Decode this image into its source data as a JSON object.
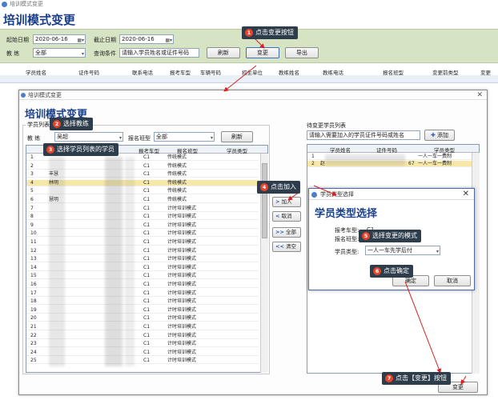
{
  "window": {
    "title": "培训模式变更"
  },
  "page": {
    "title": "培训模式变更"
  },
  "filter": {
    "start_label": "起始日期",
    "start_value": "2020-06-16",
    "end_label": "截止日期",
    "end_value": "2020-06-16",
    "coach_label": "教    练",
    "coach_value": "全部",
    "query_label": "查询条件",
    "query_placeholder": "请输入学员姓名或证件号码",
    "refresh_label": "刷新",
    "change_label": "变更",
    "export_label": "导出"
  },
  "main_table": {
    "columns": [
      "学员姓名",
      "证件号码",
      "联系电话",
      "报考车型",
      "车辆号码",
      "招生单位",
      "教练姓名",
      "教练电话",
      "报名班型",
      "变更前类型",
      "变更"
    ]
  },
  "dialog": {
    "title": "培训模式变更",
    "heading": "培训模式变更",
    "list_label": "学员列表",
    "coach_label": "教    练",
    "coach_value": "吴超",
    "class_label": "报名班型",
    "class_value": "全部",
    "refresh_label": "刷新",
    "columns": [
      "报考车型",
      "报名班型",
      "学员类型"
    ],
    "rows": [
      {
        "no": "1",
        "partial": "",
        "type": "C1",
        "class": "传统模式"
      },
      {
        "no": "2",
        "partial": "",
        "type": "C1",
        "class": "传统模式"
      },
      {
        "no": "3",
        "partial": "丰慧",
        "type": "C1",
        "class": "传统模式"
      },
      {
        "no": "4",
        "partial": "林明",
        "type": "C1",
        "class": "传统模式"
      },
      {
        "no": "5",
        "partial": "",
        "type": "C1",
        "class": "传统模式"
      },
      {
        "no": "6",
        "partial": "慧明",
        "type": "C1",
        "class": "传统模式"
      },
      {
        "no": "7",
        "partial": "",
        "type": "C1",
        "class": "计时培训模式"
      },
      {
        "no": "8",
        "partial": "",
        "type": "C1",
        "class": "计时培训模式"
      },
      {
        "no": "9",
        "partial": "",
        "type": "C1",
        "class": "计时培训模式"
      },
      {
        "no": "10",
        "partial": "",
        "type": "C1",
        "class": "计时培训模式"
      },
      {
        "no": "11",
        "partial": "",
        "type": "C1",
        "class": "计时培训模式"
      },
      {
        "no": "12",
        "partial": "",
        "type": "C1",
        "class": "计时培训模式"
      },
      {
        "no": "13",
        "partial": "",
        "type": "C1",
        "class": "计时培训模式"
      },
      {
        "no": "14",
        "partial": "",
        "type": "C1",
        "class": "计时培训模式"
      },
      {
        "no": "15",
        "partial": "",
        "type": "C1",
        "class": "计时培训模式"
      },
      {
        "no": "16",
        "partial": "",
        "type": "C1",
        "class": "计时培训模式"
      },
      {
        "no": "17",
        "partial": "",
        "type": "C1",
        "class": "计时培训模式"
      },
      {
        "no": "18",
        "partial": "",
        "type": "C1",
        "class": "计时培训模式"
      },
      {
        "no": "19",
        "partial": "",
        "type": "C1",
        "class": "计时培训模式"
      },
      {
        "no": "20",
        "partial": "",
        "type": "C1",
        "class": "计时培训模式"
      },
      {
        "no": "21",
        "partial": "",
        "type": "C1",
        "class": "计时培训模式"
      },
      {
        "no": "22",
        "partial": "",
        "type": "C1",
        "class": "计时培训模式"
      },
      {
        "no": "23",
        "partial": "",
        "type": "C1",
        "class": "计时培训模式"
      },
      {
        "no": "24",
        "partial": "",
        "type": "C1",
        "class": "计时培训模式"
      },
      {
        "no": "25",
        "partial": "",
        "type": "C1",
        "class": "计时培训模式"
      }
    ],
    "add_label": "加入",
    "remove_label": "取消",
    "all_label": "全部",
    "clear_label": "清空",
    "pending_label": "待变更学员列表",
    "pending_placeholder": "请输入需要加入的学员证件号码或姓名",
    "pending_add_label": "添加",
    "pending_columns": [
      "学员姓名",
      "证件号码",
      "学员类型"
    ],
    "pending_rows": [
      {
        "no": "1",
        "id_suffix": "",
        "type": "一人一车一费制"
      },
      {
        "no": "2",
        "name_partial": "赵",
        "id_suffix": "67",
        "type": "一人一车一费制"
      }
    ],
    "change_label": "变更"
  },
  "subdialog": {
    "title": "学员类型选择",
    "heading": "学员类型选择",
    "car_label": "报考车型:",
    "car_value": "C1",
    "class_label": "报名班型:",
    "student_type_label": "学员类型:",
    "student_type_value": "一人一车先学后付",
    "ok_label": "确定",
    "cancel_label": "取消"
  },
  "callouts": [
    {
      "num": "1",
      "text": "点击变更按钮"
    },
    {
      "num": "2",
      "text": "选择教练"
    },
    {
      "num": "3",
      "text": "选择学员列表的学员"
    },
    {
      "num": "4",
      "text": "点击加入"
    },
    {
      "num": "5",
      "text": "选择变更的模式"
    },
    {
      "num": "6",
      "text": "点击确定"
    },
    {
      "num": "7",
      "text": "点击【变更】按钮"
    }
  ],
  "colors": {
    "accent": "#1a3f8a",
    "filter_bg": "#d6e4c4",
    "highlight_row": "#f7e8a8",
    "callout_bg": "#2e3d4c",
    "callout_num": "#e8442c",
    "arrow": "#d82020"
  }
}
